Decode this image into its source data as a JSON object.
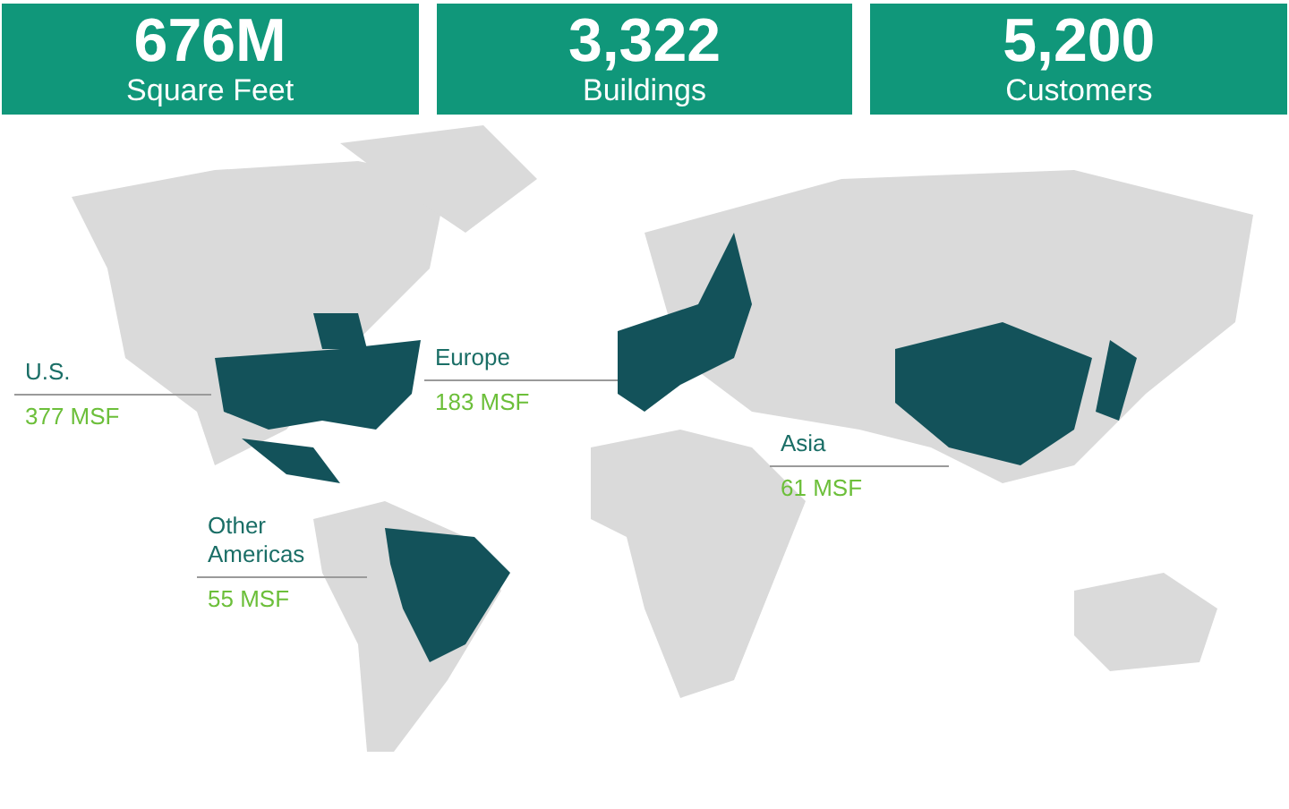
{
  "stats": [
    {
      "value": "676M",
      "label": "Square Feet"
    },
    {
      "value": "3,322",
      "label": "Buildings"
    },
    {
      "value": "5,200",
      "label": "Customers"
    }
  ],
  "regions": [
    {
      "name": "U.S.",
      "value": "377 MSF"
    },
    {
      "name": "Europe",
      "value": "183 MSF"
    },
    {
      "name": "Asia",
      "value": "61 MSF"
    },
    {
      "name": "Other Americas",
      "value": "55 MSF"
    }
  ]
}
